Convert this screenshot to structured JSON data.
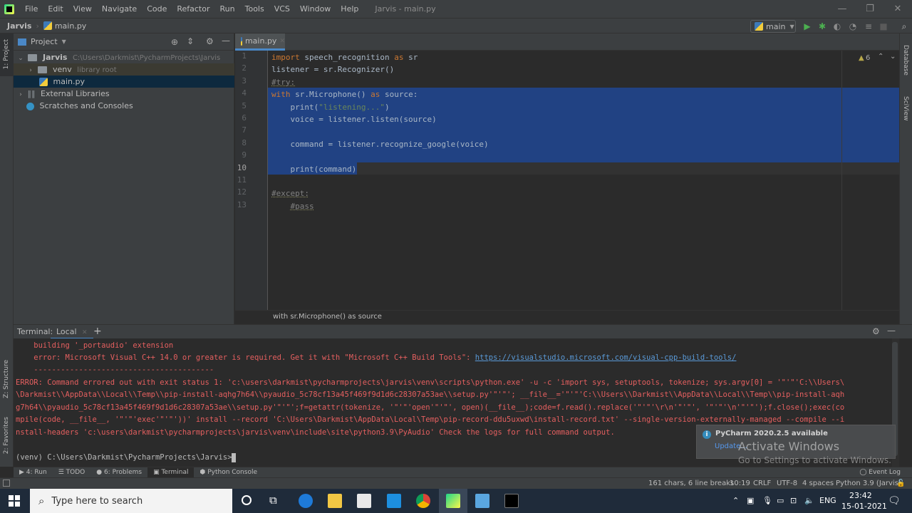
{
  "menubar": {
    "items": [
      "File",
      "Edit",
      "View",
      "Navigate",
      "Code",
      "Refactor",
      "Run",
      "Tools",
      "VCS",
      "Window",
      "Help"
    ],
    "window_title": "Jarvis - main.py",
    "controls": {
      "minimize": "—",
      "restore": "❐",
      "close": "✕"
    }
  },
  "navbar": {
    "project": "Jarvis",
    "file": "main.py",
    "run_config": "main"
  },
  "left_stripe": {
    "project": "1: Project",
    "structure": "Z: Structure",
    "favorites": "2: Favorites"
  },
  "right_stripe": {
    "database": "Database",
    "sciview": "SciView"
  },
  "project_panel": {
    "title": "Project",
    "tree": [
      {
        "label": "Jarvis",
        "hint": "C:\\Users\\Darkmist\\PycharmProjects\\Jarvis"
      },
      {
        "label": "venv",
        "hint": "library root"
      },
      {
        "label": "main.py",
        "hint": ""
      },
      {
        "label": "External Libraries",
        "hint": ""
      },
      {
        "label": "Scratches and Consoles",
        "hint": ""
      }
    ]
  },
  "editor": {
    "tab": "main.py",
    "warnings": "6",
    "line_numbers": [
      "1",
      "2",
      "3",
      "4",
      "5",
      "6",
      "7",
      "8",
      "9",
      "10",
      "11",
      "12",
      "13"
    ],
    "lines": [
      [
        {
          "t": "import ",
          "c": "kw"
        },
        {
          "t": "speech_recognition ",
          "c": ""
        },
        {
          "t": "as ",
          "c": "kw"
        },
        {
          "t": "sr",
          "c": ""
        }
      ],
      [
        {
          "t": "listener = sr.Recognizer()",
          "c": ""
        }
      ],
      [
        {
          "t": "#try:",
          "c": "cm"
        }
      ],
      [
        {
          "t": "with ",
          "c": "kw"
        },
        {
          "t": "sr.Microphone() ",
          "c": ""
        },
        {
          "t": "as ",
          "c": "kw"
        },
        {
          "t": "source:",
          "c": ""
        }
      ],
      [
        {
          "t": "    print(",
          "c": ""
        },
        {
          "t": "\"listening...\"",
          "c": "str"
        },
        {
          "t": ")",
          "c": ""
        }
      ],
      [
        {
          "t": "    voice = listener.listen(source)",
          "c": ""
        }
      ],
      [
        {
          "t": "",
          "c": ""
        }
      ],
      [
        {
          "t": "    command = listener.recognize_google(voice)",
          "c": ""
        }
      ],
      [
        {
          "t": "",
          "c": ""
        }
      ],
      [
        {
          "t": "    print(command)",
          "c": ""
        }
      ],
      [
        {
          "t": "",
          "c": ""
        }
      ],
      [
        {
          "t": "#except:",
          "c": "cm"
        }
      ],
      [
        {
          "t": "    ",
          "c": ""
        },
        {
          "t": "#pass",
          "c": "cm"
        }
      ]
    ],
    "breadcrumb": "with sr.Microphone() as source"
  },
  "terminal": {
    "label": "Terminal:",
    "tab": "Local",
    "lines": [
      "    building '_portaudio' extension",
      "    error: Microsoft Visual C++ 14.0 or greater is required. Get it with \"Microsoft C++ Build Tools\": ",
      "    ----------------------------------------",
      "ERROR: Command errored out with exit status 1: 'c:\\users\\darkmist\\pycharmprojects\\jarvis\\venv\\scripts\\python.exe' -u -c 'import sys, setuptools, tokenize; sys.argv[0] = '\"'\"'C:\\\\Users\\",
      "\\Darkmist\\\\AppData\\\\Local\\\\Temp\\\\pip-install-aqhg7h64\\\\pyaudio_5c78cf13a45f469f9d1d6c28307a53ae\\\\setup.py'\"'\"'; __file__='\"'\"'C:\\\\Users\\\\Darkmist\\\\AppData\\\\Local\\\\Temp\\\\pip-install-aqh",
      "g7h64\\\\pyaudio_5c78cf13a45f469f9d1d6c28307a53ae\\\\setup.py'\"'\"';f=getattr(tokenize, '\"'\"'open'\"'\"', open)(__file__);code=f.read().replace('\"'\"'\\r\\n'\"'\"', '\"'\"'\\n'\"'\"');f.close();exec(co",
      "mpile(code, __file__, '\"'\"'exec'\"'\"'))' install --record 'C:\\Users\\Darkmist\\AppData\\Local\\Temp\\pip-record-ddu5uxwd\\install-record.txt' --single-version-externally-managed --compile --i",
      "nstall-headers 'c:\\users\\darkmist\\pycharmprojects\\jarvis\\venv\\include\\site\\python3.9\\PyAudio' Check the logs for full command output."
    ],
    "link": "https://visualstudio.microsoft.com/visual-cpp-build-tools/",
    "prompt": "(venv) C:\\Users\\Darkmist\\PycharmProjects\\Jarvis>"
  },
  "tool_tabs": [
    "4: Run",
    "TODO",
    "6: Problems",
    "Terminal",
    "Python Console"
  ],
  "event_log": "Event Log",
  "notification": {
    "title": "PyCharm 2020.2.5 available",
    "action": "Update..."
  },
  "watermark": {
    "title": "Activate Windows",
    "subtitle": "Go to Settings to activate Windows."
  },
  "statusbar": {
    "selection": "161 chars, 6 line breaks",
    "position": "10:19",
    "line_sep": "CRLF",
    "encoding": "UTF-8",
    "indent": "4 spaces",
    "interpreter": "Python 3.9 (Jarvis)"
  },
  "taskbar": {
    "search_placeholder": "Type here to search",
    "lang": "ENG",
    "time": "23:42",
    "date": "15-01-2021"
  }
}
